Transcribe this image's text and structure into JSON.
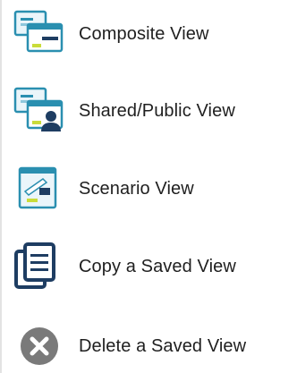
{
  "menu": {
    "items": [
      {
        "label": "Composite View",
        "icon": "composite-view-icon"
      },
      {
        "label": "Shared/Public View",
        "icon": "shared-public-view-icon"
      },
      {
        "label": "Scenario View",
        "icon": "scenario-view-icon"
      },
      {
        "label": "Copy a Saved View",
        "icon": "copy-icon"
      },
      {
        "label": "Delete a Saved View",
        "icon": "delete-icon"
      }
    ]
  },
  "colors": {
    "text": "#1f1f1f",
    "teal": "#2a8fb0",
    "navy": "#1e3d62",
    "lime": "#c9dc3a",
    "gray": "#7a7a7a"
  }
}
